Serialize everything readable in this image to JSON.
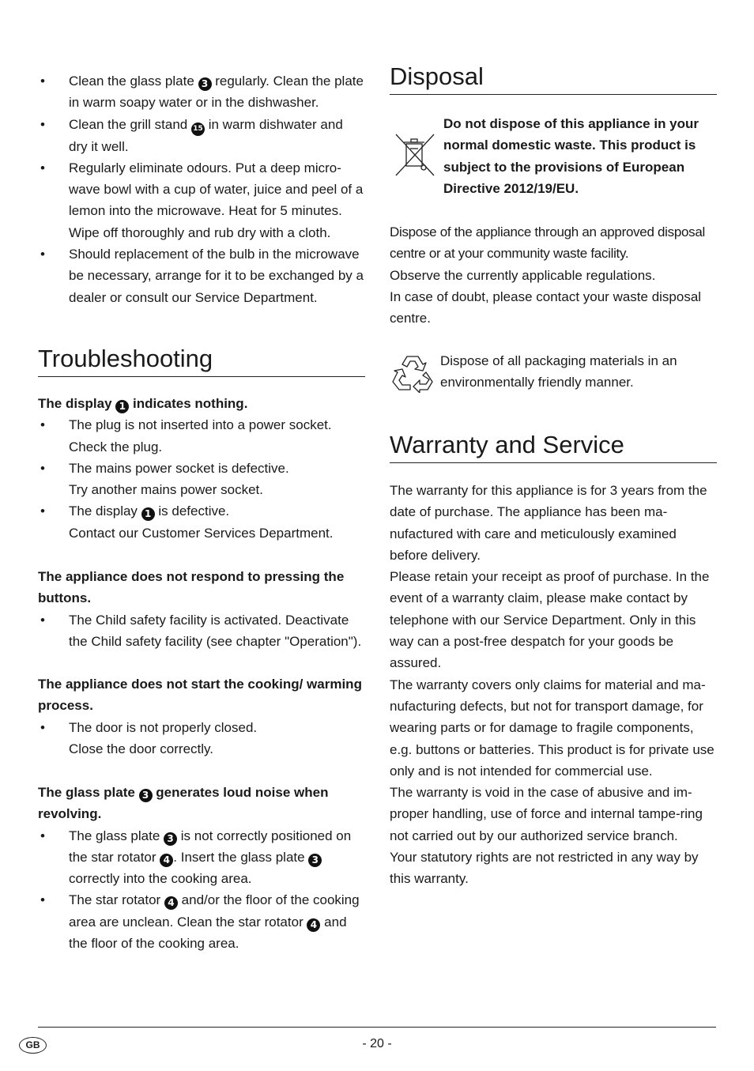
{
  "care_bullets": [
    {
      "parts": [
        "Clean the glass plate ",
        "3",
        " regularly. Clean the plate in warm soapy water or in the dishwasher."
      ]
    },
    {
      "parts": [
        "Clean the grill stand ",
        "15",
        " in warm dishwater and dry it well."
      ]
    },
    {
      "text": "Regularly eliminate odours. Put a deep micro-wave bowl with a cup of water, juice and peel of a lemon into the microwave. Heat for 5 minutes. Wipe off thoroughly and rub dry with a cloth."
    },
    {
      "text": "Should replacement of the bulb in the microwave be necessary, arrange for it to be exchanged by a dealer or consult our Service Department."
    }
  ],
  "troubleshooting": {
    "title": "Troubleshooting",
    "s1": {
      "heading_a": "The display ",
      "heading_num": "1",
      "heading_b": " indicates nothing.",
      "b1_line1": "The plug is not inserted into a power socket.",
      "b1_line2": "Check the plug.",
      "b2_line1": " The mains power socket is defective.",
      "b2_line2": "Try another mains power socket.",
      "b3_a": "The display ",
      "b3_num": "1",
      "b3_b": " is defective.",
      "b3_line2": "Contact our Customer Services Department."
    },
    "s2": {
      "heading": "The appliance does not respond to pressing the buttons.",
      "b1": "The Child safety facility is activated. Deactivate the Child safety facility (see chapter \"Operation\")."
    },
    "s3": {
      "heading": "The appliance does not start the cooking/ warming process.",
      "b1_line1": "The door is not properly closed.",
      "b1_line2": "Close the door correctly."
    },
    "s4": {
      "heading_a": "The glass plate ",
      "heading_num": "3",
      "heading_b": " generates loud noise when revolving.",
      "b1_a": "The glass plate ",
      "b1_num1": "3",
      "b1_b": " is not correctly positioned on the star rotator ",
      "b1_num2": "4",
      "b1_c": ". Insert the glass plate ",
      "b1_num3": "3",
      "b1_d": " correctly into the cooking area.",
      "b2_a": "The star rotator ",
      "b2_num1": "4",
      "b2_b": " and/or the floor of the cooking area are unclean. Clean the star rotator ",
      "b2_num2": "4",
      "b2_c": " and the floor of the cooking area."
    }
  },
  "disposal": {
    "title": "Disposal",
    "weee_icon": "crossed-out-wheelie-bin-icon",
    "weee_text": "Do not dispose of this appliance in your normal domestic waste. This product is subject to the provisions of European Directive 2012/19/EU.",
    "para1": "Dispose of the appliance through an approved disposal centre or at your community waste facility.",
    "para2": "Observe the currently applicable regulations.",
    "para3": "In case of doubt, please contact your waste disposal centre.",
    "recycle_icon": "recycling-icon",
    "recycle_text": "Dispose of all packaging materials in an environmentally friendly manner."
  },
  "warranty": {
    "title": "Warranty and Service",
    "p1": "The warranty for this appliance is for 3 years from the date of purchase. The appliance has been ma-nufactured with care and meticulously examined before delivery.",
    "p2": "Please retain your receipt as proof of purchase. In the event of a warranty claim, please make contact by telephone with our Service Department. Only in this way can a post-free despatch for your goods be assured.",
    "p3": "The warranty covers only claims for material and ma-nufacturing defects, but not for transport damage, for wearing parts or for damage to fragile components, e.g. buttons or batteries. This product is for private use only and is not intended for commercial use.",
    "p4": "The warranty is void in the case of abusive and im-proper handling, use of force and internal tampe-ring not carried out by our authorized service branch.",
    "p5": "Your statutory rights are not restricted in any way by this warranty."
  },
  "footer": {
    "country_badge": "GB",
    "page_number": "- 20 -"
  }
}
